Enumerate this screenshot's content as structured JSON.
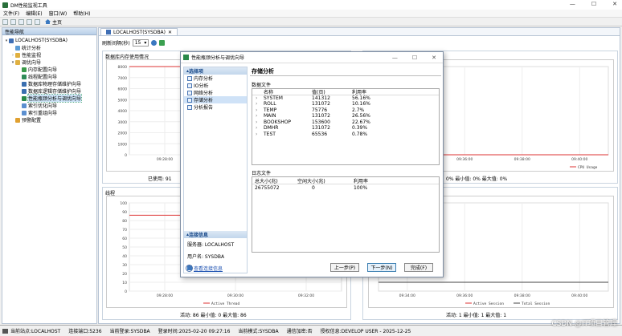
{
  "app": {
    "title": "DM性能监视工具"
  },
  "window_controls": [
    "—",
    "☐",
    "✕"
  ],
  "menu": [
    "文件(F)",
    "编辑(E)",
    "窗口(W)",
    "帮助(H)"
  ],
  "toolbar": {
    "home_label": "主页"
  },
  "nav": {
    "header": "性能导航",
    "items": [
      {
        "label": "LOCALHOST(SYSDBA)"
      },
      {
        "label": "统计分析"
      },
      {
        "label": "性能监视"
      },
      {
        "label": "调优向导"
      },
      {
        "label": "内存配置向导"
      },
      {
        "label": "线程配置向导"
      },
      {
        "label": "数据库物理存储维护向导"
      },
      {
        "label": "数据库逻辑存储维护向导"
      },
      {
        "label": "性能瓶颈分析与调优向导"
      },
      {
        "label": "索引优化向导"
      },
      {
        "label": "索引重组向导"
      },
      {
        "label": "预警配置"
      }
    ]
  },
  "main": {
    "tab_label": "LOCALHOST(SYSDBA)",
    "refresh_label": "刷新间隔(秒)",
    "refresh_value": "15",
    "chart1": {
      "title": "数据库内存使用情况",
      "stats_left": "已使用: 91",
      "stats_right": "0%  最小值: 0%  最大值: 0%"
    },
    "chart2": {
      "title": "线程",
      "stats": "活动: 86   最小值: 0   最大值: 86"
    },
    "chart3": {
      "stats": "活动: 1   最小值: 1   最大值: 1"
    }
  },
  "chart_data": [
    {
      "type": "line",
      "title": "数据库内存使用情况",
      "x": [
        "09:28:00",
        "09:30:00",
        "09:32:00"
      ],
      "yticks": [
        0,
        1000,
        2000,
        3000,
        4000,
        5000,
        6000,
        7000,
        8000
      ],
      "series": [
        {
          "values": [
            8000,
            8000,
            8000
          ]
        }
      ]
    },
    {
      "type": "line",
      "title": "",
      "x": [
        "09:34:00",
        "09:36:00",
        "09:38:00",
        "09:40:00"
      ],
      "series": [
        {
          "name": "CPU Usage",
          "values": [
            0,
            0,
            0,
            0
          ]
        }
      ]
    },
    {
      "type": "line",
      "title": "线程",
      "x": [
        "09:28:00",
        "09:30:00",
        "09:32:00"
      ],
      "yticks": [
        0,
        10,
        20,
        30,
        40,
        50,
        60,
        70,
        80,
        90,
        100
      ],
      "series": [
        {
          "name": "Active Thread",
          "values": [
            86,
            86,
            86
          ]
        }
      ]
    },
    {
      "type": "line",
      "title": "",
      "x": [
        "09:34:00",
        "09:36:00",
        "09:38:00",
        "09:40:00"
      ],
      "series": [
        {
          "name": "Active Session",
          "values": [
            1,
            1,
            1,
            1
          ]
        },
        {
          "name": "Total Session",
          "values": [
            1,
            1,
            1,
            1
          ]
        }
      ]
    }
  ],
  "dialog": {
    "title": "性能瓶颈分析与调优向导",
    "nav_section": "选择项",
    "nav_items": [
      "内存分析",
      "IO分析",
      "网络分析",
      "存储分析",
      "分析报告"
    ],
    "active_index": 3,
    "conn_section": "连接信息",
    "server": "服务器: LOCALHOST",
    "user": "用户名: SYSDBA",
    "conn_link": "查看连接信息",
    "heading": "存储分析",
    "data_file_group": "数据文件",
    "data_cols": [
      "名称",
      "值(页)",
      "利用率"
    ],
    "data_rows": [
      [
        "SYSTEM",
        "141312",
        "56.16%"
      ],
      [
        "ROLL",
        "131072",
        "10.16%"
      ],
      [
        "TEMP",
        "75776",
        "2.7%"
      ],
      [
        "MAIN",
        "131072",
        "26.56%"
      ],
      [
        "BOOKSHOP",
        "153600",
        "22.67%"
      ],
      [
        "DMHR",
        "131072",
        "0.39%"
      ],
      [
        "TEST",
        "65536",
        "0.78%"
      ]
    ],
    "log_group": "日志文件",
    "log_cols": [
      "总大小(兆)",
      "空闲大小(兆)",
      "利用率"
    ],
    "log_rows": [
      [
        "26755072",
        "0",
        "100%"
      ]
    ],
    "btn_prev": "上一步(P)",
    "btn_next": "下一步(N)",
    "btn_finish": "完成(F)"
  },
  "status": {
    "site": "当前站点:LOCALHOST",
    "conn": "连接端口:5236",
    "login": "当前登录:SYSDBA",
    "time": "登录时间:2025-02-20 09:27:16",
    "mode": "当前模式:SYSDBA",
    "notify": "通信加密:否",
    "license": "授权信息:DEVELOP USER - 2025-12-25"
  },
  "watermark": "CSDN @IT项目管理"
}
